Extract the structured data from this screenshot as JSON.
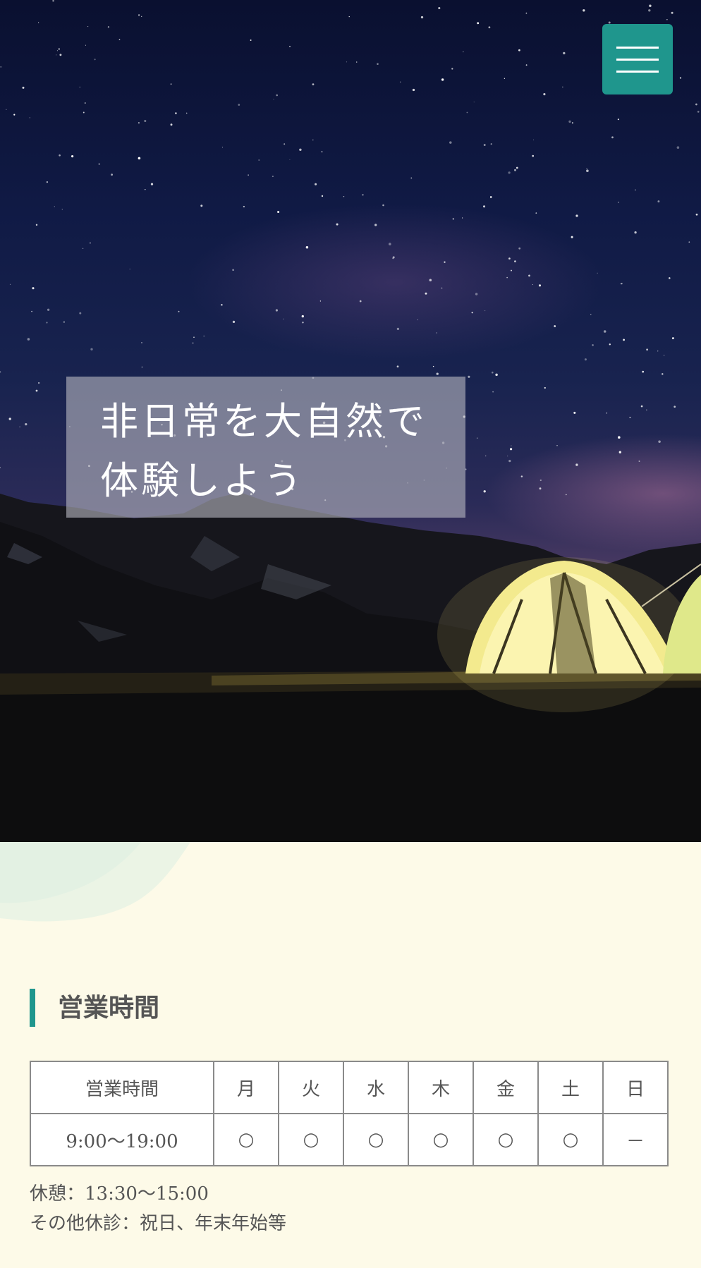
{
  "hero": {
    "headline_line1": "非日常を大自然で",
    "headline_line2": "体験しよう"
  },
  "menu": {
    "icon": "hamburger-menu-icon",
    "color": "#1f968d"
  },
  "hours_section": {
    "title": "営業時間",
    "accent_color": "#1f968d",
    "table": {
      "headers": [
        "営業時間",
        "月",
        "火",
        "水",
        "木",
        "金",
        "土",
        "日"
      ],
      "rows": [
        [
          "9:00〜19:00",
          "○",
          "○",
          "○",
          "○",
          "○",
          "○",
          "－"
        ]
      ]
    },
    "notes": [
      "休憩：13:30〜15:00",
      "その他休診：祝日、年末年始等"
    ]
  }
}
